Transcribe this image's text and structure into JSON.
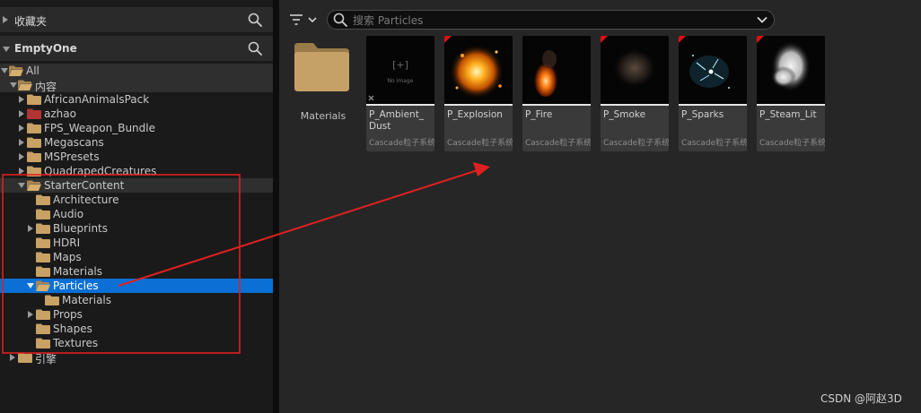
{
  "left_panel": {
    "favorites": {
      "title": "收藏夹"
    },
    "project": {
      "title": "EmptyOne"
    },
    "tree": [
      {
        "label": "All"
      },
      {
        "label": "内容"
      },
      {
        "label": "AfricanAnimalsPack"
      },
      {
        "label": "azhao"
      },
      {
        "label": "FPS_Weapon_Bundle"
      },
      {
        "label": "Megascans"
      },
      {
        "label": "MSPresets"
      },
      {
        "label": "QuadrapedCreatures"
      },
      {
        "label": "StarterContent"
      },
      {
        "label": "Architecture"
      },
      {
        "label": "Audio"
      },
      {
        "label": "Blueprints"
      },
      {
        "label": "HDRI"
      },
      {
        "label": "Maps"
      },
      {
        "label": "Materials"
      },
      {
        "label": "Particles"
      },
      {
        "label": "Materials"
      },
      {
        "label": "Props"
      },
      {
        "label": "Shapes"
      },
      {
        "label": "Textures"
      },
      {
        "label": "引擎"
      }
    ]
  },
  "content": {
    "search": {
      "placeholder": "搜索 Particles",
      "value": ""
    },
    "folder": {
      "label": "Materials"
    },
    "assets": [
      {
        "name": "P_Ambient_ Dust",
        "type": "Cascade粒子系统",
        "thumb_text": "No Image"
      },
      {
        "name": "P_Explosion",
        "type": "Cascade粒子系统"
      },
      {
        "name": "P_Fire",
        "type": "Cascade粒子系统"
      },
      {
        "name": "P_Smoke",
        "type": "Cascade粒子系统"
      },
      {
        "name": "P_Sparks",
        "type": "Cascade粒子系统"
      },
      {
        "name": "P_Steam_Lit",
        "type": "Cascade粒子系统"
      }
    ]
  },
  "annotation": {
    "color": "#e02020"
  },
  "watermark": "CSDN @阿赵3D",
  "colors": {
    "selection": "#0a70d6",
    "folder": "#c8a165",
    "red_folder": "#b03535",
    "flag": "#e01010"
  }
}
